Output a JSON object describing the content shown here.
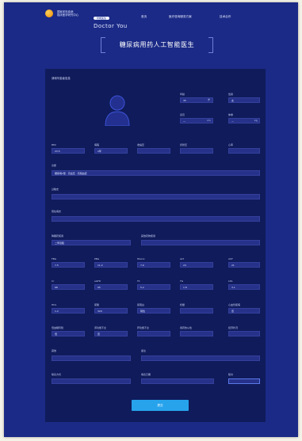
{
  "header": {
    "logo_line1": "国家老年疾病",
    "logo_line2": "临床医学研究中心",
    "brand_badge": "智能医生",
    "brand_name": "Doctor You",
    "nav": [
      "首页",
      "医疗咨询服务方案",
      "技术合作"
    ]
  },
  "page_title": "糖尿病用药人工智能医生",
  "panel_title": "请填写患者信息",
  "demographics": {
    "age": {
      "label": "年龄",
      "value": "35",
      "unit": "岁"
    },
    "sex": {
      "label": "性别",
      "value": "女"
    },
    "height": {
      "label": "身高",
      "value": "—",
      "unit": "cm"
    },
    "weight": {
      "label": "体重",
      "value": "—",
      "unit": "kg"
    }
  },
  "row_a": [
    {
      "label": "BMI",
      "value": "23.5"
    },
    {
      "label": "病程",
      "value": "2年"
    },
    {
      "label": "收缩压",
      "value": ""
    },
    {
      "label": "舒张压",
      "value": ""
    },
    {
      "label": "心率",
      "value": ""
    }
  ],
  "diagnosis": {
    "label": "诊断",
    "value": "糖尿病2型 · 高血压 · 高脂血症"
  },
  "allergy": {
    "label": "过敏史",
    "value": ""
  },
  "history": {
    "label": "既往病史",
    "value": ""
  },
  "row_b": [
    {
      "label": "降糖药使用",
      "value": "二甲双胍"
    },
    {
      "label": "其他药物使用",
      "value": ""
    }
  ],
  "row_c": [
    {
      "label": "FBG",
      "value": "7.5"
    },
    {
      "label": "PBG",
      "value": "11.2"
    },
    {
      "label": "HbA1c",
      "value": "7.6"
    },
    {
      "label": "ALT",
      "value": "24"
    },
    {
      "label": "AST",
      "value": "21"
    }
  ],
  "row_d": [
    {
      "label": "Cr",
      "value": "68"
    },
    {
      "label": "eGFR",
      "value": "95"
    },
    {
      "label": "TC",
      "value": "5.2"
    },
    {
      "label": "TG",
      "value": "1.8"
    },
    {
      "label": "LDL",
      "value": "3.1"
    }
  ],
  "row_e": [
    {
      "label": "HDL",
      "value": "1.2"
    },
    {
      "label": "尿酸",
      "value": "320"
    },
    {
      "label": "尿蛋白",
      "value": "阴性"
    },
    {
      "label": "妊娠",
      "value": ""
    },
    {
      "label": "心血管疾病",
      "value": "否"
    }
  ],
  "row_f": [
    {
      "label": "低血糖风险",
      "value": "低"
    },
    {
      "label": "肾功能不全",
      "value": "否"
    },
    {
      "label": "肝功能不全",
      "value": ""
    },
    {
      "label": "用药依从性",
      "value": ""
    },
    {
      "label": "经济状况",
      "value": ""
    }
  ],
  "row_g": [
    {
      "label": "其他",
      "value": ""
    },
    {
      "label": "备注",
      "value": ""
    }
  ],
  "row_h": [
    {
      "label": "联系方式",
      "value": ""
    },
    {
      "label": "填表日期",
      "value": ""
    },
    {
      "label": "随访",
      "value": ""
    }
  ],
  "submit_label": "提交"
}
